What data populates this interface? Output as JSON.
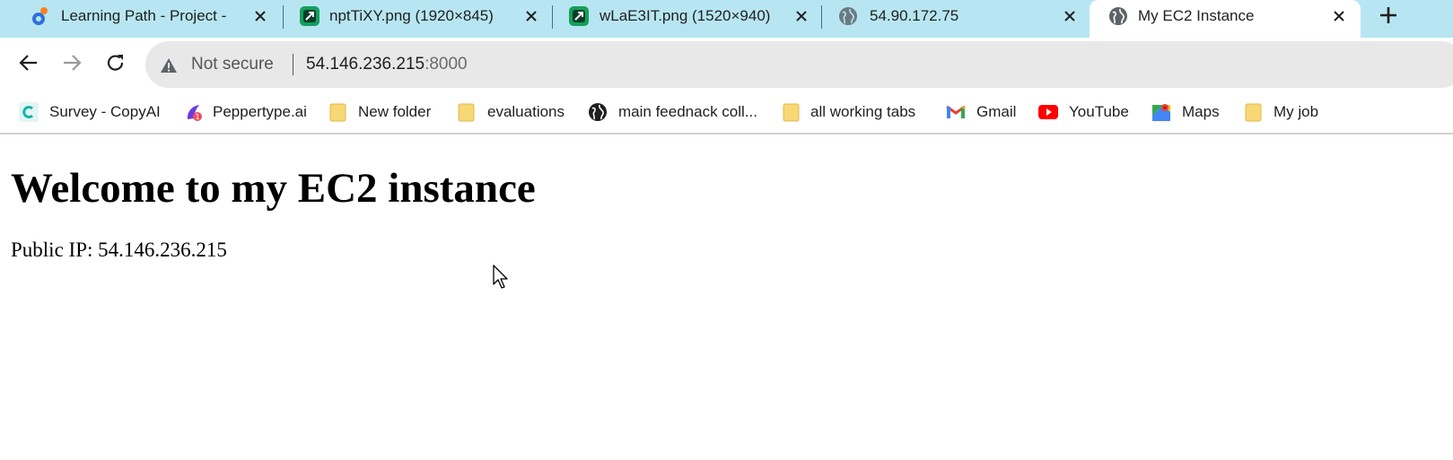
{
  "tabs": [
    {
      "title": "Learning Path - Project - ",
      "favicon": "project-app-icon",
      "active": false
    },
    {
      "title": "nptTiXY.png (1920×845)",
      "favicon": "image-viewer-icon",
      "active": false
    },
    {
      "title": "wLaE3IT.png (1520×940)",
      "favicon": "image-viewer-icon",
      "active": false
    },
    {
      "title": "54.90.172.75",
      "favicon": "globe-icon",
      "active": false
    },
    {
      "title": "My EC2 Instance",
      "favicon": "globe-icon",
      "active": true
    }
  ],
  "new_tab": "plus-icon",
  "toolbar": {
    "security_label": "Not secure",
    "url_host": "54.146.236.215",
    "url_port": ":8000"
  },
  "bookmarks": [
    {
      "label": "Survey - CopyAI",
      "icon": "copyai-icon"
    },
    {
      "label": "Peppertype.ai",
      "icon": "peppertype-icon"
    },
    {
      "label": "New folder",
      "icon": "folder-icon"
    },
    {
      "label": "evaluations",
      "icon": "folder-icon"
    },
    {
      "label": "main feednack coll...",
      "icon": "globe-icon"
    },
    {
      "label": "all working tabs",
      "icon": "folder-icon"
    },
    {
      "label": "Gmail",
      "icon": "gmail-icon"
    },
    {
      "label": "YouTube",
      "icon": "youtube-icon"
    },
    {
      "label": "Maps",
      "icon": "maps-icon"
    },
    {
      "label": "My job",
      "icon": "folder-icon"
    }
  ],
  "page": {
    "heading": "Welcome to my EC2 instance",
    "ip_text": "Public IP: 54.146.236.215"
  },
  "colors": {
    "tabstrip": "#b7e6f2",
    "omnibox": "#e8e8e8",
    "folder": "#f8d775"
  }
}
